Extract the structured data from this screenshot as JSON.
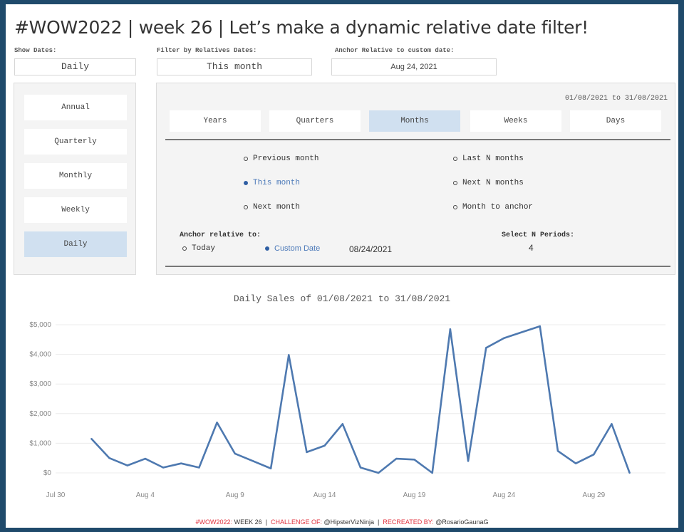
{
  "title": "#WOW2022 | week 26 | Let’s make a dynamic relative date filter!",
  "controls": {
    "show_dates": {
      "label": "Show Dates:",
      "value": "Daily"
    },
    "filter_relative": {
      "label": "Filter by Relatives Dates:",
      "value": "This month"
    },
    "anchor_custom": {
      "label": "Anchor Relative to custom date:",
      "value": "Aug 24, 2021"
    }
  },
  "granularity": [
    {
      "label": "Annual",
      "active": false
    },
    {
      "label": "Quarterly",
      "active": false
    },
    {
      "label": "Monthly",
      "active": false
    },
    {
      "label": "Weekly",
      "active": false
    },
    {
      "label": "Daily",
      "active": true
    }
  ],
  "range_text": "01/08/2021 to 31/08/2021",
  "tabs": [
    {
      "label": "Years",
      "active": false
    },
    {
      "label": "Quarters",
      "active": false
    },
    {
      "label": "Months",
      "active": true
    },
    {
      "label": "Weeks",
      "active": false
    },
    {
      "label": "Days",
      "active": false
    }
  ],
  "options": [
    {
      "label": "Previous month",
      "selected": false
    },
    {
      "label": "This month",
      "selected": true
    },
    {
      "label": "Next month",
      "selected": false
    },
    {
      "label": "Last N months",
      "selected": false
    },
    {
      "label": "Next N months",
      "selected": false
    },
    {
      "label": "Month to anchor",
      "selected": false
    }
  ],
  "anchor": {
    "label": "Anchor relative to:",
    "today": "Today",
    "custom": "Custom Date",
    "date": "08/24/2021"
  },
  "n_periods": {
    "label": "Select N Periods:",
    "value": "4"
  },
  "colors": {
    "line": "#4e79b0",
    "active_fill": "#d0e0f0",
    "background": "#1f4a6b",
    "accent_red": "#e0333f"
  },
  "chart_data": {
    "type": "line",
    "title": "Daily Sales of 01/08/2021 to 31/08/2021",
    "xlabel": "",
    "ylabel": "",
    "x_ticks": [
      "Jul 30",
      "Aug 4",
      "Aug 9",
      "Aug 14",
      "Aug 19",
      "Aug 24",
      "Aug 29"
    ],
    "y_ticks": [
      "$0",
      "$1,000",
      "$2,000",
      "$3,000",
      "$4,000",
      "$5,000"
    ],
    "ylim": [
      0,
      5000
    ],
    "x": [
      "2021-08-01",
      "2021-08-02",
      "2021-08-03",
      "2021-08-04",
      "2021-08-05",
      "2021-08-06",
      "2021-08-07",
      "2021-08-08",
      "2021-08-09",
      "2021-08-10",
      "2021-08-11",
      "2021-08-12",
      "2021-08-13",
      "2021-08-14",
      "2021-08-15",
      "2021-08-16",
      "2021-08-17",
      "2021-08-18",
      "2021-08-19",
      "2021-08-20",
      "2021-08-21",
      "2021-08-22",
      "2021-08-23",
      "2021-08-24",
      "2021-08-25",
      "2021-08-26",
      "2021-08-27",
      "2021-08-28",
      "2021-08-29",
      "2021-08-30",
      "2021-08-31"
    ],
    "series": [
      {
        "values": [
          1150,
          500,
          250,
          480,
          180,
          320,
          180,
          1700,
          650,
          400,
          150,
          3980,
          700,
          920,
          1650,
          180,
          0,
          480,
          450,
          0,
          4850,
          400,
          4220,
          4550,
          4750,
          4950,
          740,
          320,
          620,
          1650,
          0
        ]
      }
    ],
    "grid": "horizontal"
  },
  "footer": {
    "tag": "#WOW2022:",
    "week": "WEEK 26",
    "challenge_label": "CHALLENGE OF:",
    "challenge_by": "@HipsterVizNinja",
    "recreated_label": "RECREATED BY:",
    "recreated_by": "@RosarioGaunaG",
    "sep": "|"
  }
}
